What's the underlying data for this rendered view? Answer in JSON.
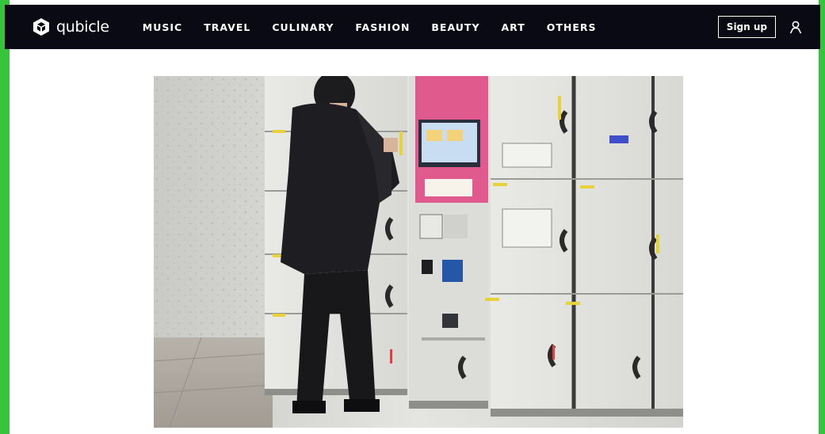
{
  "header": {
    "brand_name": "qubicle",
    "nav_items": [
      "MUSIC",
      "TRAVEL",
      "CULINARY",
      "FASHION",
      "BEAUTY",
      "ART",
      "OTHERS"
    ],
    "signup_label": "Sign up"
  },
  "colors": {
    "header_bg": "#0a0a14",
    "side_accent": "#36c43c",
    "page_bg": "#ffffff",
    "locker_pink": "#e05a8e"
  },
  "icons": {
    "brand": "qubicle-cube-logo-icon",
    "user": "user-account-icon"
  },
  "hero_image": {
    "subject": "coin-locker-photo"
  }
}
